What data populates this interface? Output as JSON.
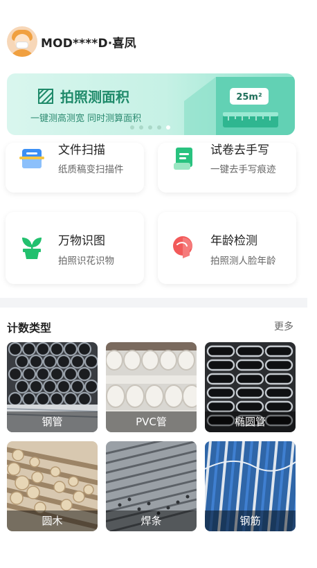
{
  "user": {
    "name": "MOD****D·喜凤"
  },
  "banner": {
    "title": "拍照测面积",
    "subtitle": "一键测高测宽 同时测算面积",
    "badge": "25m²",
    "dots": 5,
    "active_dot": 4
  },
  "features": [
    {
      "title": "文件扫描",
      "subtitle": "纸质稿变扫描件",
      "icon": "scan-document-icon",
      "color": "#3b8ff5"
    },
    {
      "title": "试卷去手写",
      "subtitle": "一键去手写痕迹",
      "icon": "exam-paper-icon",
      "color": "#29c27f"
    },
    {
      "title": "万物识图",
      "subtitle": "拍照识花识物",
      "icon": "plant-icon",
      "color": "#22c06e"
    },
    {
      "title": "年龄检测",
      "subtitle": "拍照测人脸年龄",
      "icon": "face-profile-icon",
      "color": "#f25a5a"
    }
  ],
  "count_section": {
    "title": "计数类型",
    "more": "更多",
    "items": [
      {
        "label": "钢管"
      },
      {
        "label": "PVC管"
      },
      {
        "label": "椭圆管"
      },
      {
        "label": "圆木"
      },
      {
        "label": "焊条"
      },
      {
        "label": "钢筋"
      }
    ]
  }
}
